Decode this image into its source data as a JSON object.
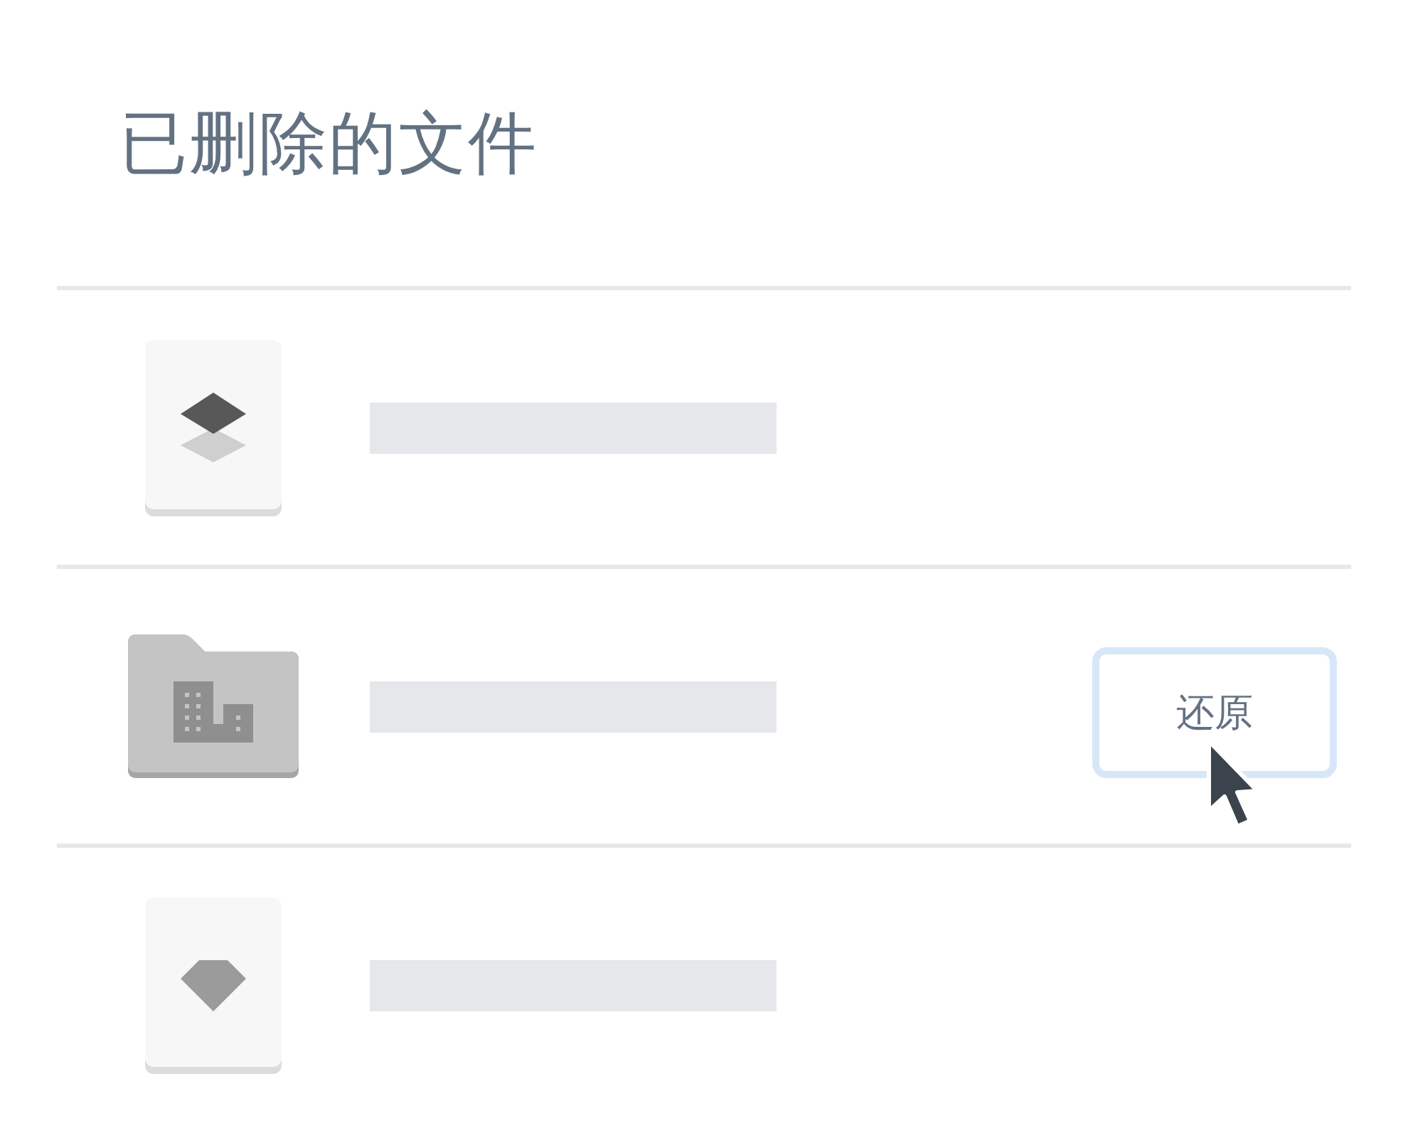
{
  "title": "已删除的文件",
  "files": [
    {
      "kind": "stack-file",
      "hovered": false
    },
    {
      "kind": "folder",
      "hovered": true,
      "restore_button": {
        "label": "还原"
      }
    },
    {
      "kind": "gem-file",
      "hovered": false
    }
  ]
}
